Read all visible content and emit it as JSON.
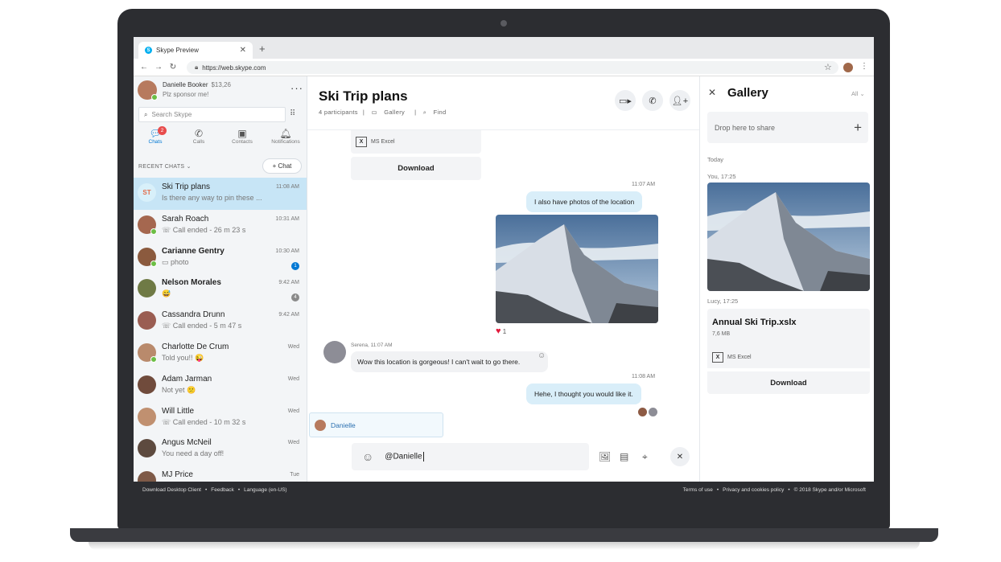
{
  "browser": {
    "tab_title": "Skype Preview",
    "tab_close": "✕",
    "new_tab": "+",
    "url": "https://web.skype.com"
  },
  "profile": {
    "name": "Danielle Booker",
    "credit": "$13,26",
    "status": "Plz sponsor me!",
    "more": "···"
  },
  "search": {
    "placeholder": "Search Skype"
  },
  "nav": [
    {
      "label": "Chats",
      "icon": "chat-icon",
      "badge": "2",
      "active": true
    },
    {
      "label": "Calls",
      "icon": "phone-icon"
    },
    {
      "label": "Contacts",
      "icon": "contacts-icon"
    },
    {
      "label": "Notifications",
      "icon": "bell-icon"
    }
  ],
  "recent_chats_label": "RECENT CHATS",
  "new_chat_label": "+ Chat",
  "chats": [
    {
      "name": "Ski Trip plans",
      "initials": "ST",
      "preview": "Is there any way to pin these ...",
      "time": "11:08 AM",
      "active": true
    },
    {
      "name": "Sarah Roach",
      "preview": "Call ended - 26 m 23 s",
      "time": "10:31 AM",
      "call": true,
      "online": true
    },
    {
      "name": "Carianne Gentry",
      "preview": "photo",
      "time": "10:30 AM",
      "bold": true,
      "unread": "1",
      "online": true
    },
    {
      "name": "Nelson Morales",
      "preview": "😅",
      "time": "9:42 AM",
      "bold": true,
      "unread": "4",
      "unread_grey": true
    },
    {
      "name": "Cassandra Drunn",
      "preview": "Call ended - 5 m 47 s",
      "time": "9:42 AM",
      "call": true
    },
    {
      "name": "Charlotte De Crum",
      "preview": "Told you!! 😜",
      "time": "Wed",
      "online": true
    },
    {
      "name": "Adam Jarman",
      "preview": "Not yet 😕",
      "time": "Wed"
    },
    {
      "name": "Will Little",
      "preview": "Call ended - 10 m 32 s",
      "time": "Wed",
      "call": true
    },
    {
      "name": "Angus McNeil",
      "preview": "You need a day off!",
      "time": "Wed"
    },
    {
      "name": "MJ Price",
      "preview": "",
      "time": "Tue"
    }
  ],
  "conversation": {
    "title": "Ski Trip plans",
    "participants": "4 participants",
    "gallery_link": "Gallery",
    "find_link": "Find",
    "file_type": "MS Excel",
    "download": "Download",
    "time_1107": "11:07 AM",
    "msg_photos": "I also have photos of the location",
    "reaction_count": "1",
    "serena_meta": "Serena, 11:07 AM",
    "serena_msg": "Wow this location is gorgeous! I can't wait to go there.",
    "time_1108": "11:08 AM",
    "msg_reply": "Hehe, I thought you would like it.",
    "mention_name": "Danielle",
    "compose_text": "@Danielle"
  },
  "gallery": {
    "title": "Gallery",
    "filter": "All",
    "drop_label": "Drop here to share",
    "today": "Today",
    "photo_meta": "You, 17:25",
    "file_meta": "Lucy, 17:25",
    "file_name": "Annual Ski Trip.xslx",
    "file_size": "7,6 MB",
    "file_type": "MS Excel",
    "download": "Download"
  },
  "footer": {
    "download_client": "Download Desktop Client",
    "feedback": "Feedback",
    "language": "Language (en-US)",
    "terms": "Terms of use",
    "privacy": "Privacy and cookies policy",
    "copyright": "© 2018 Skype and/or Microsoft"
  },
  "colors": {
    "accent": "#0078d4",
    "active_chat": "#c7e5f6",
    "outgoing_bubble": "#d9eef9",
    "badge_red": "#e84c4c",
    "online_green": "#6bbe45",
    "laptop": "#2c2d31"
  }
}
